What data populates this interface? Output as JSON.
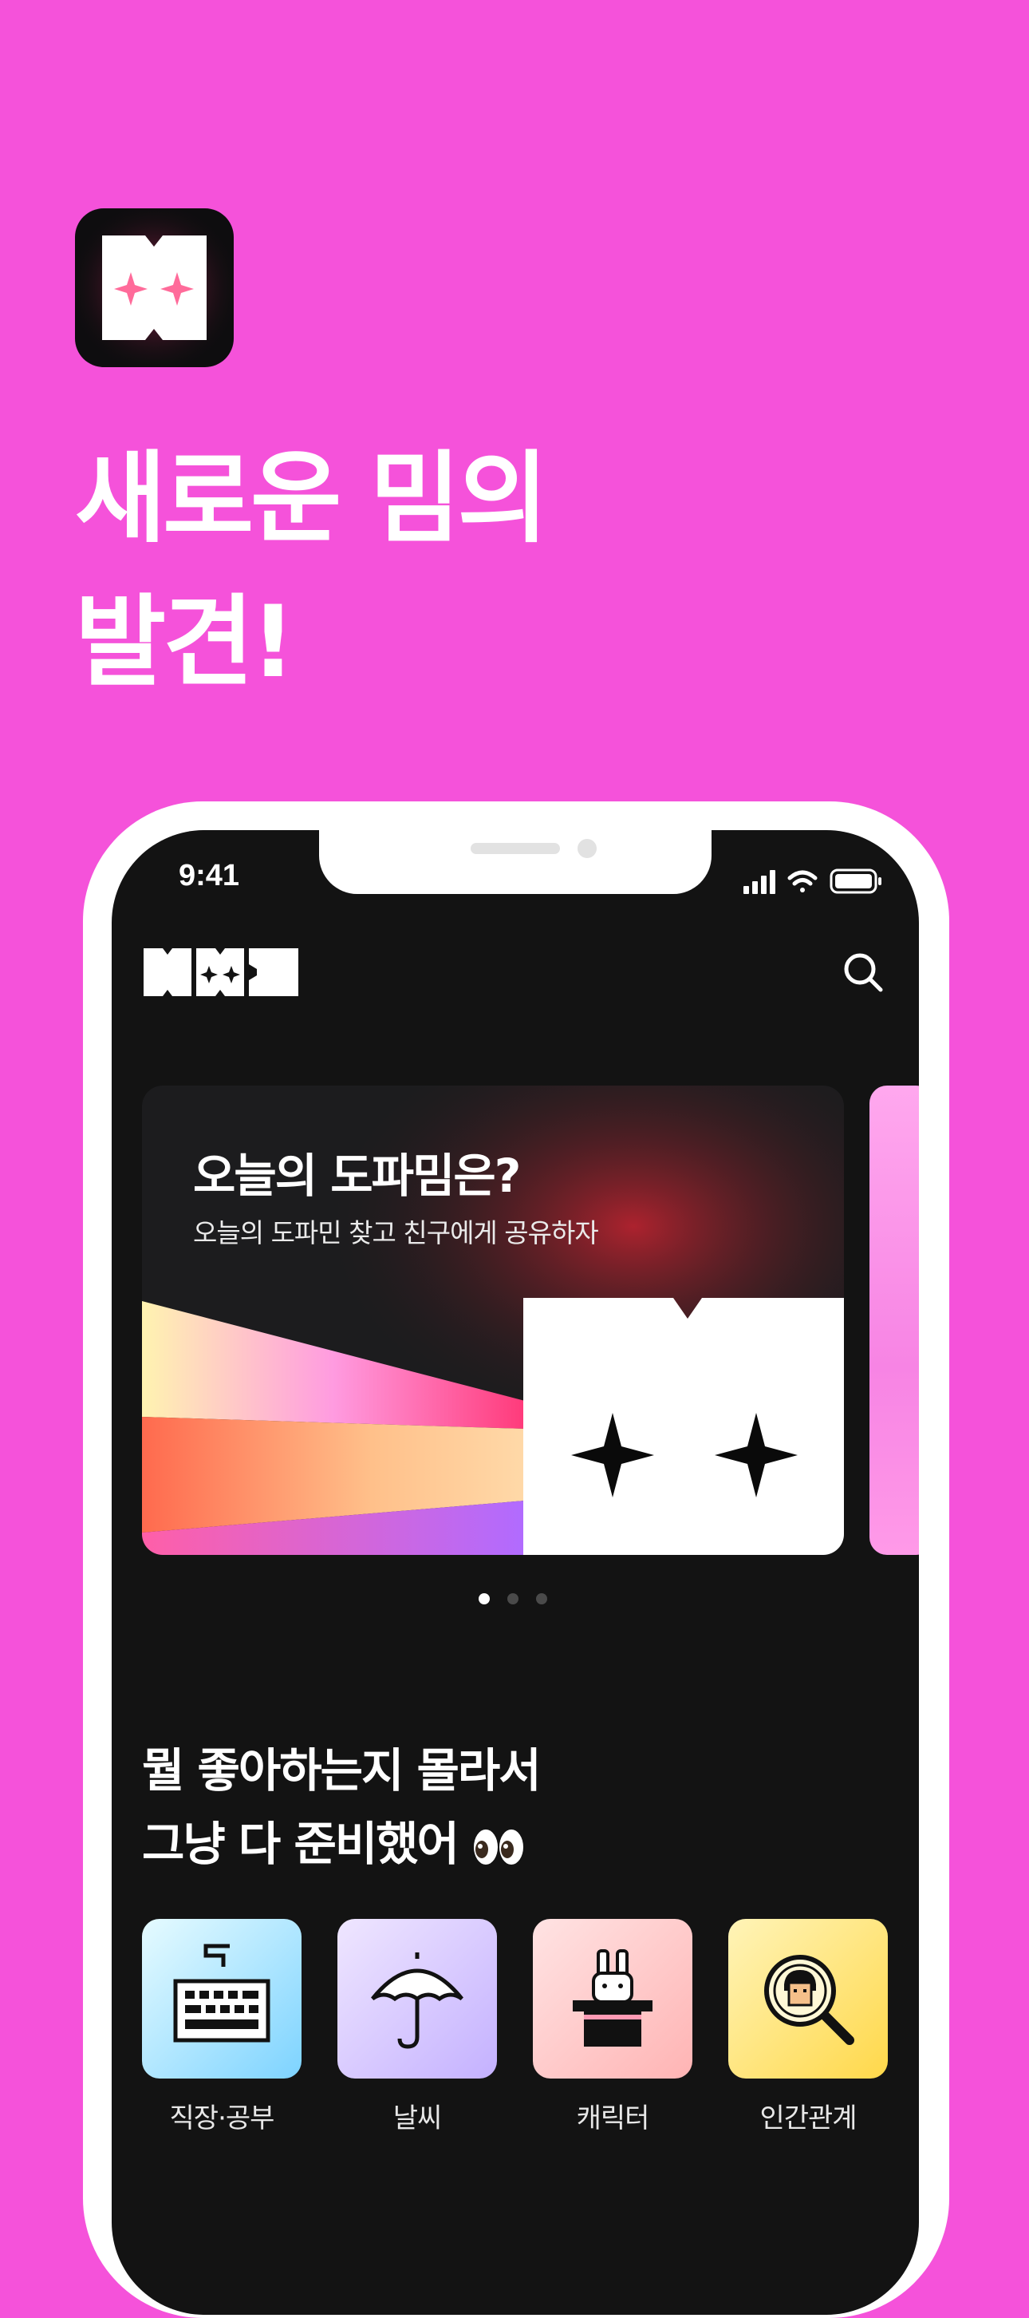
{
  "promo": {
    "headline_line1": "새로운 밈의",
    "headline_line2": "발견!",
    "background": "#f552da"
  },
  "status_bar": {
    "time": "9:41"
  },
  "app_bar": {
    "logo_icon": "mm-logo",
    "search_icon": "search-icon"
  },
  "banner": {
    "title": "오늘의 도파밈은?",
    "subtitle": "오늘의 도파민 찾고 친구에게 공유하자",
    "page_count": 3,
    "active_page": 1
  },
  "section": {
    "title_line1": "뭘 좋아하는지 몰라서",
    "title_line2": "그냥 다 준비했어",
    "emoji": "👀"
  },
  "categories": [
    {
      "label": "직장·공부",
      "icon": "keyboard-icon",
      "gradient": [
        "#e6fbff",
        "#7dd3ff"
      ]
    },
    {
      "label": "날씨",
      "icon": "umbrella-icon",
      "gradient": [
        "#efe6ff",
        "#c4b1ff"
      ]
    },
    {
      "label": "캐릭터",
      "icon": "rabbit-in-hat-icon",
      "gradient": [
        "#ffe3e3",
        "#ffb4b4"
      ]
    },
    {
      "label": "인간관계",
      "icon": "magnifier-person-icon",
      "gradient": [
        "#fff4b8",
        "#ffd84a"
      ]
    }
  ]
}
